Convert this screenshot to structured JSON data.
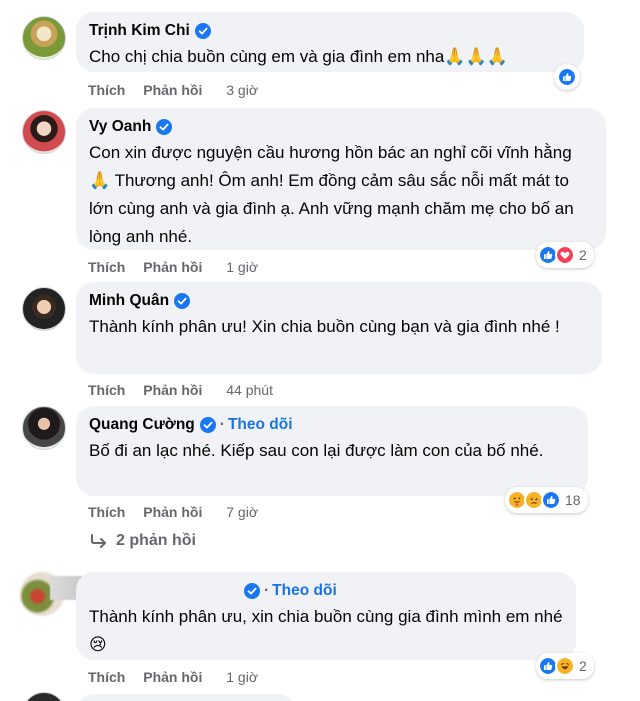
{
  "comments": [
    {
      "author": "Trịnh Kim Chi",
      "text": "Cho chị chia buồn cùng em và gia đình em nha🙏🙏🙏",
      "like_label": "Thích",
      "reply_label": "Phản hồi",
      "time": "3 giờ",
      "reaction_count": ""
    },
    {
      "author": "Vy Oanh",
      "text": "Con xin được nguyện cầu hương hồn bác an nghỉ cõi vĩnh hằng 🙏 Thương anh! Ôm anh! Em đồng cảm sâu sắc nỗi mất mát to lớn cùng anh và gia đình ạ. Anh vững mạnh chăm mẹ cho bố an lòng anh nhé.",
      "like_label": "Thích",
      "reply_label": "Phản hồi",
      "time": "1 giờ",
      "reaction_count": "2"
    },
    {
      "author": "Minh Quân",
      "text": "Thành kính phân ưu! Xin chia buồn cùng bạn và gia đình nhé !",
      "like_label": "Thích",
      "reply_label": "Phản hồi",
      "time": "44 phút",
      "reaction_count": ""
    },
    {
      "author": "Quang Cường",
      "follow": "Theo dõi",
      "text": "Bố đi an lạc nhé. Kiếp sau con lại được làm con của bố nhé.",
      "like_label": "Thích",
      "reply_label": "Phản hồi",
      "time": "7 giờ",
      "reaction_count": "18"
    },
    {
      "author": "",
      "follow": "Theo dõi",
      "text": "Thành kính phân ưu, xin chia buồn cùng gia đình mình em nhé😢",
      "like_label": "Thích",
      "reply_label": "Phản hồi",
      "time": "1 giờ",
      "reaction_count": "2"
    }
  ],
  "replies_link": "2 phản hồi",
  "icons": {
    "verified": "verified-badge-icon",
    "like": "like-reaction-icon",
    "love": "love-reaction-icon",
    "care": "care-reaction-icon",
    "sad": "sad-reaction-icon",
    "haha": "haha-reaction-icon",
    "reply_arrow": "reply-arrow-icon"
  },
  "colors": {
    "bubble": "#f0f2f5",
    "secondary_text": "#65676b",
    "link_blue": "#1b74e4",
    "verified_blue": "#1877f2",
    "love_red": "#f33e58"
  }
}
